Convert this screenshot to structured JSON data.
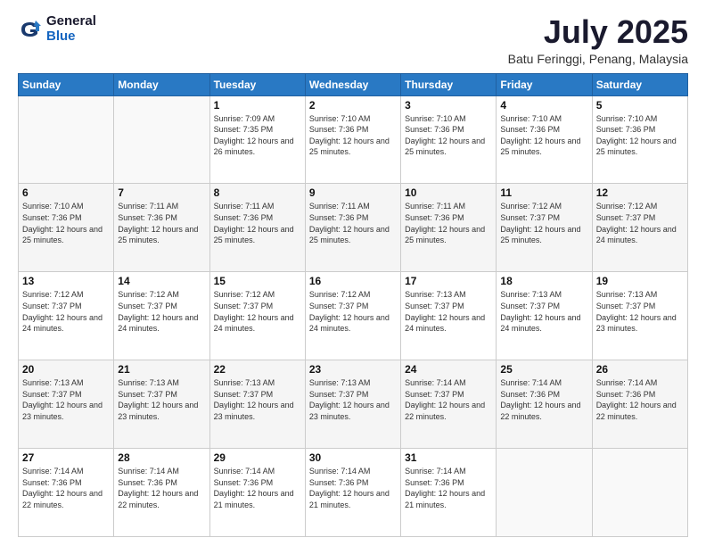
{
  "logo": {
    "general": "General",
    "blue": "Blue"
  },
  "header": {
    "month": "July 2025",
    "location": "Batu Feringgi, Penang, Malaysia"
  },
  "days_of_week": [
    "Sunday",
    "Monday",
    "Tuesday",
    "Wednesday",
    "Thursday",
    "Friday",
    "Saturday"
  ],
  "weeks": [
    [
      {
        "day": "",
        "sunrise": "",
        "sunset": "",
        "daylight": ""
      },
      {
        "day": "",
        "sunrise": "",
        "sunset": "",
        "daylight": ""
      },
      {
        "day": "1",
        "sunrise": "Sunrise: 7:09 AM",
        "sunset": "Sunset: 7:35 PM",
        "daylight": "Daylight: 12 hours and 26 minutes."
      },
      {
        "day": "2",
        "sunrise": "Sunrise: 7:10 AM",
        "sunset": "Sunset: 7:36 PM",
        "daylight": "Daylight: 12 hours and 25 minutes."
      },
      {
        "day": "3",
        "sunrise": "Sunrise: 7:10 AM",
        "sunset": "Sunset: 7:36 PM",
        "daylight": "Daylight: 12 hours and 25 minutes."
      },
      {
        "day": "4",
        "sunrise": "Sunrise: 7:10 AM",
        "sunset": "Sunset: 7:36 PM",
        "daylight": "Daylight: 12 hours and 25 minutes."
      },
      {
        "day": "5",
        "sunrise": "Sunrise: 7:10 AM",
        "sunset": "Sunset: 7:36 PM",
        "daylight": "Daylight: 12 hours and 25 minutes."
      }
    ],
    [
      {
        "day": "6",
        "sunrise": "Sunrise: 7:10 AM",
        "sunset": "Sunset: 7:36 PM",
        "daylight": "Daylight: 12 hours and 25 minutes."
      },
      {
        "day": "7",
        "sunrise": "Sunrise: 7:11 AM",
        "sunset": "Sunset: 7:36 PM",
        "daylight": "Daylight: 12 hours and 25 minutes."
      },
      {
        "day": "8",
        "sunrise": "Sunrise: 7:11 AM",
        "sunset": "Sunset: 7:36 PM",
        "daylight": "Daylight: 12 hours and 25 minutes."
      },
      {
        "day": "9",
        "sunrise": "Sunrise: 7:11 AM",
        "sunset": "Sunset: 7:36 PM",
        "daylight": "Daylight: 12 hours and 25 minutes."
      },
      {
        "day": "10",
        "sunrise": "Sunrise: 7:11 AM",
        "sunset": "Sunset: 7:36 PM",
        "daylight": "Daylight: 12 hours and 25 minutes."
      },
      {
        "day": "11",
        "sunrise": "Sunrise: 7:12 AM",
        "sunset": "Sunset: 7:37 PM",
        "daylight": "Daylight: 12 hours and 25 minutes."
      },
      {
        "day": "12",
        "sunrise": "Sunrise: 7:12 AM",
        "sunset": "Sunset: 7:37 PM",
        "daylight": "Daylight: 12 hours and 24 minutes."
      }
    ],
    [
      {
        "day": "13",
        "sunrise": "Sunrise: 7:12 AM",
        "sunset": "Sunset: 7:37 PM",
        "daylight": "Daylight: 12 hours and 24 minutes."
      },
      {
        "day": "14",
        "sunrise": "Sunrise: 7:12 AM",
        "sunset": "Sunset: 7:37 PM",
        "daylight": "Daylight: 12 hours and 24 minutes."
      },
      {
        "day": "15",
        "sunrise": "Sunrise: 7:12 AM",
        "sunset": "Sunset: 7:37 PM",
        "daylight": "Daylight: 12 hours and 24 minutes."
      },
      {
        "day": "16",
        "sunrise": "Sunrise: 7:12 AM",
        "sunset": "Sunset: 7:37 PM",
        "daylight": "Daylight: 12 hours and 24 minutes."
      },
      {
        "day": "17",
        "sunrise": "Sunrise: 7:13 AM",
        "sunset": "Sunset: 7:37 PM",
        "daylight": "Daylight: 12 hours and 24 minutes."
      },
      {
        "day": "18",
        "sunrise": "Sunrise: 7:13 AM",
        "sunset": "Sunset: 7:37 PM",
        "daylight": "Daylight: 12 hours and 24 minutes."
      },
      {
        "day": "19",
        "sunrise": "Sunrise: 7:13 AM",
        "sunset": "Sunset: 7:37 PM",
        "daylight": "Daylight: 12 hours and 23 minutes."
      }
    ],
    [
      {
        "day": "20",
        "sunrise": "Sunrise: 7:13 AM",
        "sunset": "Sunset: 7:37 PM",
        "daylight": "Daylight: 12 hours and 23 minutes."
      },
      {
        "day": "21",
        "sunrise": "Sunrise: 7:13 AM",
        "sunset": "Sunset: 7:37 PM",
        "daylight": "Daylight: 12 hours and 23 minutes."
      },
      {
        "day": "22",
        "sunrise": "Sunrise: 7:13 AM",
        "sunset": "Sunset: 7:37 PM",
        "daylight": "Daylight: 12 hours and 23 minutes."
      },
      {
        "day": "23",
        "sunrise": "Sunrise: 7:13 AM",
        "sunset": "Sunset: 7:37 PM",
        "daylight": "Daylight: 12 hours and 23 minutes."
      },
      {
        "day": "24",
        "sunrise": "Sunrise: 7:14 AM",
        "sunset": "Sunset: 7:37 PM",
        "daylight": "Daylight: 12 hours and 22 minutes."
      },
      {
        "day": "25",
        "sunrise": "Sunrise: 7:14 AM",
        "sunset": "Sunset: 7:36 PM",
        "daylight": "Daylight: 12 hours and 22 minutes."
      },
      {
        "day": "26",
        "sunrise": "Sunrise: 7:14 AM",
        "sunset": "Sunset: 7:36 PM",
        "daylight": "Daylight: 12 hours and 22 minutes."
      }
    ],
    [
      {
        "day": "27",
        "sunrise": "Sunrise: 7:14 AM",
        "sunset": "Sunset: 7:36 PM",
        "daylight": "Daylight: 12 hours and 22 minutes."
      },
      {
        "day": "28",
        "sunrise": "Sunrise: 7:14 AM",
        "sunset": "Sunset: 7:36 PM",
        "daylight": "Daylight: 12 hours and 22 minutes."
      },
      {
        "day": "29",
        "sunrise": "Sunrise: 7:14 AM",
        "sunset": "Sunset: 7:36 PM",
        "daylight": "Daylight: 12 hours and 21 minutes."
      },
      {
        "day": "30",
        "sunrise": "Sunrise: 7:14 AM",
        "sunset": "Sunset: 7:36 PM",
        "daylight": "Daylight: 12 hours and 21 minutes."
      },
      {
        "day": "31",
        "sunrise": "Sunrise: 7:14 AM",
        "sunset": "Sunset: 7:36 PM",
        "daylight": "Daylight: 12 hours and 21 minutes."
      },
      {
        "day": "",
        "sunrise": "",
        "sunset": "",
        "daylight": ""
      },
      {
        "day": "",
        "sunrise": "",
        "sunset": "",
        "daylight": ""
      }
    ]
  ]
}
